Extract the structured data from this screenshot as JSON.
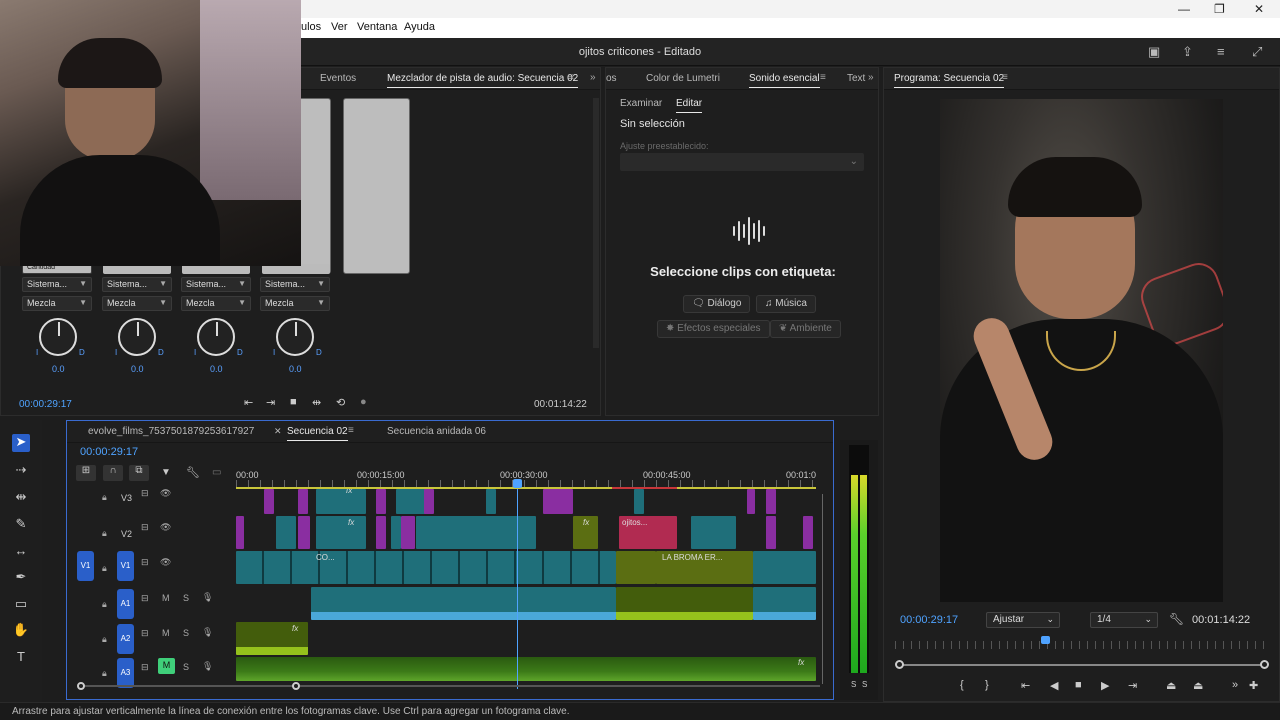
{
  "window": {
    "menu_items": [
      "ulos",
      "Ver",
      "Ventana",
      "Ayuda"
    ],
    "doc_title": "ojitos criticones - Editado",
    "min": "—",
    "max": "❐",
    "close": "✕"
  },
  "audio_mixer": {
    "tabs": [
      "Eventos",
      "Mezclador de pista de audio: Secuencia 02"
    ],
    "channels": [
      {
        "top": "Cantidad",
        "sys": "Sistema...",
        "mix": "Mezcla",
        "value": "0.0"
      },
      {
        "top": "",
        "sys": "Sistema...",
        "mix": "Mezcla",
        "value": "0.0"
      },
      {
        "top": "",
        "sys": "Sistema...",
        "mix": "Mezcla",
        "value": "0.0"
      },
      {
        "top": "",
        "sys": "Sistema...",
        "mix": "Mezcla",
        "value": "0.0"
      }
    ],
    "knob_left": "I",
    "knob_right": "D",
    "timecode_left": "00:00:29:17",
    "timecode_right": "00:01:14:22"
  },
  "essential_sound": {
    "tabs": [
      "os",
      "Color de Lumetri",
      "Sonido esencial",
      "Text"
    ],
    "subtabs": [
      "Examinar",
      "Editar"
    ],
    "no_selection": "Sin selección",
    "preset_label": "Ajuste preestablecido:",
    "prompt": "Seleccione clips con etiqueta:",
    "buttons": [
      {
        "label": "Diálogo",
        "enabled": true
      },
      {
        "label": "Música",
        "enabled": true
      },
      {
        "label": "Efectos especiales",
        "enabled": false
      },
      {
        "label": "Ambiente",
        "enabled": false
      }
    ]
  },
  "program_monitor": {
    "title": "Programa: Secuencia 02",
    "timecode_current": "00:00:29:17",
    "fit": "Ajustar",
    "resolution": "1/4",
    "timecode_total": "00:01:14:22",
    "playhead_fraction": 0.4
  },
  "timeline": {
    "tabs": [
      "evolve_films_7537501879253617927",
      "Secuencia 02",
      "Secuencia anidada 06"
    ],
    "timecode": "00:00:29:17",
    "ruler": [
      "00:00",
      "00:00:15:00",
      "00:00:30:00",
      "00:00:45:00",
      "00:01:0"
    ],
    "tracks": [
      {
        "label": "V3"
      },
      {
        "label": "V2"
      },
      {
        "label": "V1",
        "source": "V1"
      },
      {
        "label": "A1",
        "m": "M",
        "s": "S"
      },
      {
        "label": "A2",
        "m": "M",
        "s": "S"
      },
      {
        "label": "A3",
        "m": "M",
        "s": "S"
      }
    ],
    "clip_labels": {
      "v2_pink": "ojitos...",
      "v1_co": "CO...",
      "v1_broma": "LA BROMA ER..."
    },
    "fx": "fx"
  },
  "meters": {
    "solo_left": "S",
    "solo_right": "S"
  },
  "status": "Arrastre para ajustar verticalmente la línea de conexión entre los fotogramas clave. Use Ctrl para agregar un fotograma clave.",
  "colors": {
    "accent": "#2a5fc9",
    "timecode": "#4fa3ff",
    "v1_clip": "#1f6f7a",
    "v_purple": "#8a2ea1",
    "a_green": "#95c21c"
  }
}
